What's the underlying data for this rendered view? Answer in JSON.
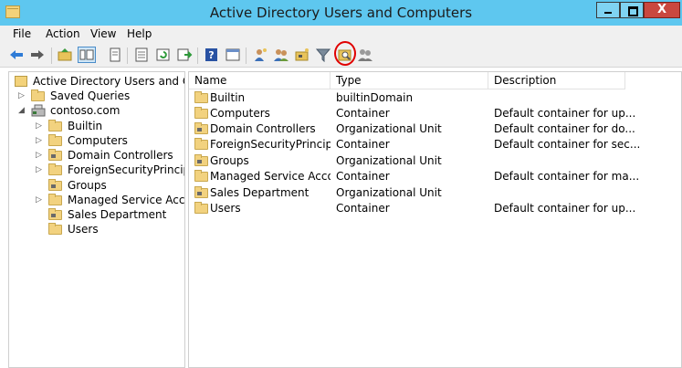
{
  "window": {
    "title": "Active Directory Users and Computers",
    "close_glyph": "X"
  },
  "menu": [
    "File",
    "Action",
    "View",
    "Help"
  ],
  "toolbar": {
    "icons": [
      "back-icon",
      "forward-icon",
      "up-folder-icon",
      "show-hide-tree-icon",
      "delete-icon",
      "properties-icon",
      "refresh-icon",
      "export-list-icon",
      "help-icon",
      "console-icon",
      "create-user-icon",
      "create-group-icon",
      "create-ou-icon",
      "filter-icon",
      "find-icon",
      "add-to-group-icon"
    ],
    "highlighted": "find-icon",
    "highlight_color": "#e00000"
  },
  "tree": {
    "root": "Active Directory Users and Com",
    "saved_queries": "Saved Queries",
    "domain": "contoso.com",
    "children": [
      "Builtin",
      "Computers",
      "Domain Controllers",
      "ForeignSecurityPrincipals",
      "Groups",
      "Managed Service Accour",
      "Sales Department",
      "Users"
    ]
  },
  "list": {
    "columns": [
      "Name",
      "Type",
      "Description"
    ],
    "rows": [
      {
        "name": "Builtin",
        "type": "builtinDomain",
        "description": ""
      },
      {
        "name": "Computers",
        "type": "Container",
        "description": "Default container for up..."
      },
      {
        "name": "Domain Controllers",
        "type": "Organizational Unit",
        "description": "Default container for do..."
      },
      {
        "name": "ForeignSecurityPrincip...",
        "type": "Container",
        "description": "Default container for sec..."
      },
      {
        "name": "Groups",
        "type": "Organizational Unit",
        "description": ""
      },
      {
        "name": "Managed Service Acco...",
        "type": "Container",
        "description": "Default container for ma..."
      },
      {
        "name": "Sales Department",
        "type": "Organizational Unit",
        "description": ""
      },
      {
        "name": "Users",
        "type": "Container",
        "description": "Default container for up..."
      }
    ]
  }
}
